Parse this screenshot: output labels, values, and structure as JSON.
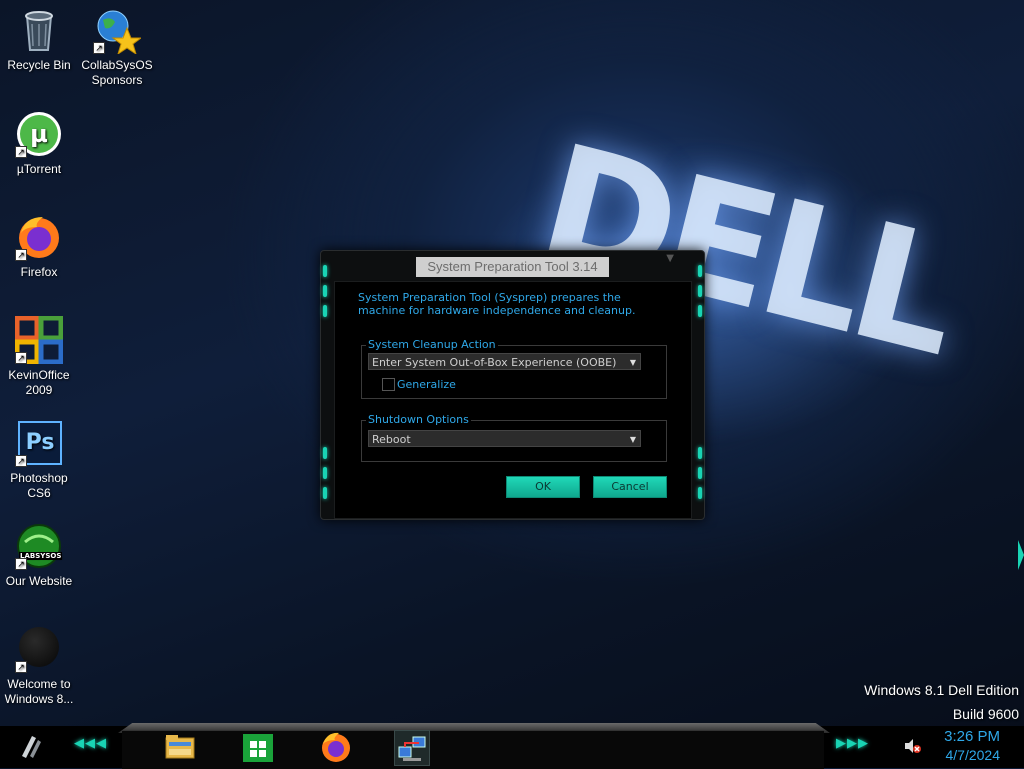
{
  "desktop": {
    "brand_text": "DELL",
    "icons": [
      {
        "label": "Recycle Bin"
      },
      {
        "label": "CollabSysOS Sponsors"
      },
      {
        "label": "µTorrent"
      },
      {
        "label": "Firefox"
      },
      {
        "label": "KevinOffice 2009"
      },
      {
        "label": "Photoshop CS6"
      },
      {
        "label": "Our Website"
      },
      {
        "label": "Welcome to Windows 8..."
      }
    ],
    "website_logo_text": "LABSYSOS",
    "photoshop_text": "Ps",
    "watermark": {
      "edition": "Windows 8.1 Dell Edition",
      "build": "Build 9600"
    }
  },
  "dialog": {
    "title": "System Preparation Tool 3.14",
    "description": "System Preparation Tool (Sysprep) prepares the machine for hardware independence and cleanup.",
    "cleanup_group_label": "System Cleanup Action",
    "cleanup_action_value": "Enter System Out-of-Box Experience (OOBE)",
    "generalize_label": "Generalize",
    "generalize_checked": false,
    "shutdown_group_label": "Shutdown Options",
    "shutdown_value": "Reboot",
    "ok_label": "OK",
    "cancel_label": "Cancel"
  },
  "taskbar": {
    "apps": [
      "file-explorer-icon",
      "store-icon",
      "firefox-icon",
      "network-icon"
    ],
    "chevrons_left": "◀◀◀",
    "chevrons_right": "▶▶▶",
    "time": "3:26 PM",
    "date": "4/7/2024",
    "volume_muted": true
  },
  "colors": {
    "accent": "#19d4b4",
    "text_blue": "#2fa8e8"
  }
}
